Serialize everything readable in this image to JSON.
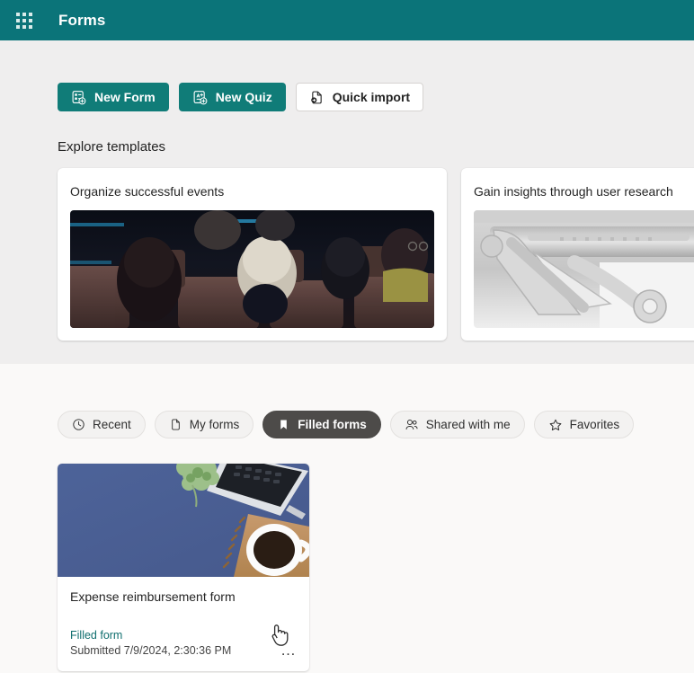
{
  "header": {
    "waffle_icon": "waffle-grid-icon",
    "title": "Forms"
  },
  "actions": {
    "new_form": {
      "label": "New Form",
      "icon": "new-form-icon"
    },
    "new_quiz": {
      "label": "New Quiz",
      "icon": "new-quiz-icon"
    },
    "quick_import": {
      "label": "Quick import",
      "icon": "import-document-icon"
    }
  },
  "templates_section": {
    "title": "Explore templates",
    "cards": [
      {
        "title": "Organize successful events",
        "thumb": "auditorium-audience-photo"
      },
      {
        "title": "Gain insights through user research",
        "thumb": "3d-printed-part-photo"
      }
    ]
  },
  "pivots": [
    {
      "label": "Recent",
      "icon": "clock-icon",
      "selected": false
    },
    {
      "label": "My forms",
      "icon": "document-icon",
      "selected": false
    },
    {
      "label": "Filled forms",
      "icon": "bookmark-icon",
      "selected": true
    },
    {
      "label": "Shared with me",
      "icon": "people-icon",
      "selected": false
    },
    {
      "label": "Favorites",
      "icon": "star-icon",
      "selected": false
    }
  ],
  "form_cards": [
    {
      "name": "Expense reimbursement form",
      "status": "Filled form",
      "submitted": "Submitted 7/9/2024, 2:30:36 PM",
      "overflow": "…",
      "thumb": "desk-with-laptop-coffee-photo"
    }
  ],
  "colors": {
    "header_teal": "#0b7479",
    "primary_teal": "#107c78",
    "status_teal": "#0f6e6e",
    "selected_pivot": "#4d4b49",
    "top_background": "#efeeee",
    "bottom_background": "#faf9f8"
  }
}
